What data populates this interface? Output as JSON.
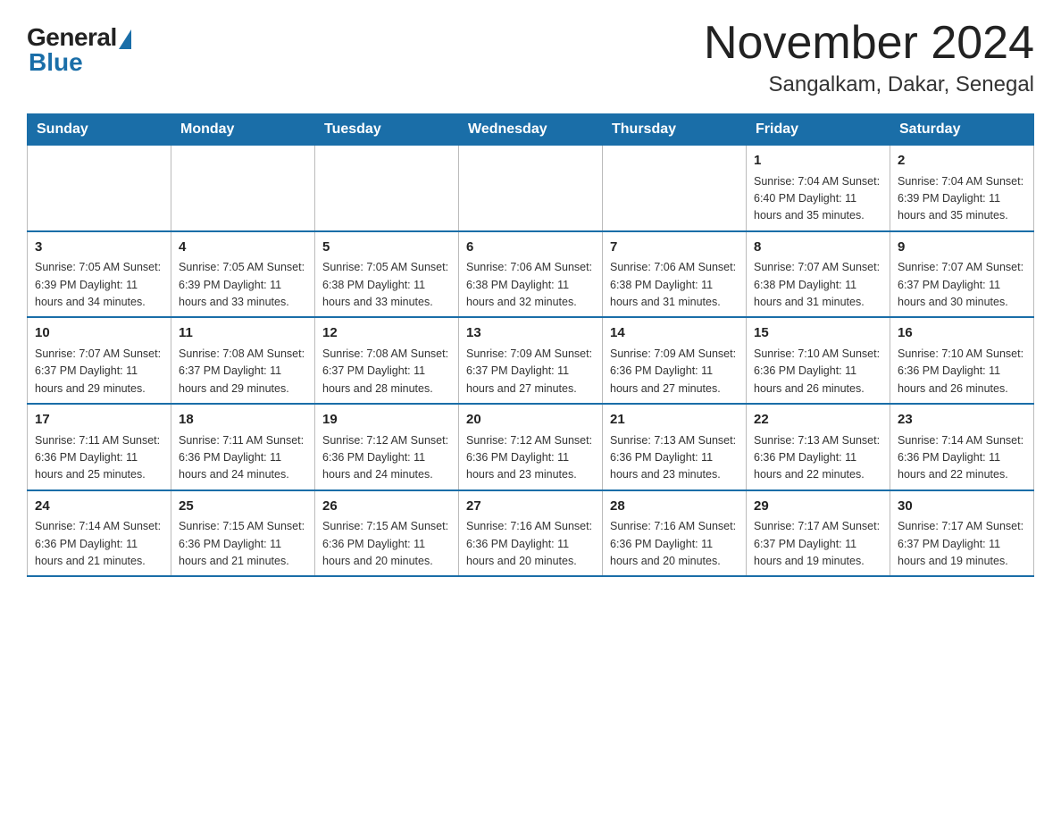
{
  "header": {
    "logo": {
      "general": "General",
      "blue": "Blue"
    },
    "month_title": "November 2024",
    "location": "Sangalkam, Dakar, Senegal"
  },
  "days_of_week": [
    "Sunday",
    "Monday",
    "Tuesday",
    "Wednesday",
    "Thursday",
    "Friday",
    "Saturday"
  ],
  "weeks": [
    [
      {
        "day": "",
        "info": ""
      },
      {
        "day": "",
        "info": ""
      },
      {
        "day": "",
        "info": ""
      },
      {
        "day": "",
        "info": ""
      },
      {
        "day": "",
        "info": ""
      },
      {
        "day": "1",
        "info": "Sunrise: 7:04 AM\nSunset: 6:40 PM\nDaylight: 11 hours and 35 minutes."
      },
      {
        "day": "2",
        "info": "Sunrise: 7:04 AM\nSunset: 6:39 PM\nDaylight: 11 hours and 35 minutes."
      }
    ],
    [
      {
        "day": "3",
        "info": "Sunrise: 7:05 AM\nSunset: 6:39 PM\nDaylight: 11 hours and 34 minutes."
      },
      {
        "day": "4",
        "info": "Sunrise: 7:05 AM\nSunset: 6:39 PM\nDaylight: 11 hours and 33 minutes."
      },
      {
        "day": "5",
        "info": "Sunrise: 7:05 AM\nSunset: 6:38 PM\nDaylight: 11 hours and 33 minutes."
      },
      {
        "day": "6",
        "info": "Sunrise: 7:06 AM\nSunset: 6:38 PM\nDaylight: 11 hours and 32 minutes."
      },
      {
        "day": "7",
        "info": "Sunrise: 7:06 AM\nSunset: 6:38 PM\nDaylight: 11 hours and 31 minutes."
      },
      {
        "day": "8",
        "info": "Sunrise: 7:07 AM\nSunset: 6:38 PM\nDaylight: 11 hours and 31 minutes."
      },
      {
        "day": "9",
        "info": "Sunrise: 7:07 AM\nSunset: 6:37 PM\nDaylight: 11 hours and 30 minutes."
      }
    ],
    [
      {
        "day": "10",
        "info": "Sunrise: 7:07 AM\nSunset: 6:37 PM\nDaylight: 11 hours and 29 minutes."
      },
      {
        "day": "11",
        "info": "Sunrise: 7:08 AM\nSunset: 6:37 PM\nDaylight: 11 hours and 29 minutes."
      },
      {
        "day": "12",
        "info": "Sunrise: 7:08 AM\nSunset: 6:37 PM\nDaylight: 11 hours and 28 minutes."
      },
      {
        "day": "13",
        "info": "Sunrise: 7:09 AM\nSunset: 6:37 PM\nDaylight: 11 hours and 27 minutes."
      },
      {
        "day": "14",
        "info": "Sunrise: 7:09 AM\nSunset: 6:36 PM\nDaylight: 11 hours and 27 minutes."
      },
      {
        "day": "15",
        "info": "Sunrise: 7:10 AM\nSunset: 6:36 PM\nDaylight: 11 hours and 26 minutes."
      },
      {
        "day": "16",
        "info": "Sunrise: 7:10 AM\nSunset: 6:36 PM\nDaylight: 11 hours and 26 minutes."
      }
    ],
    [
      {
        "day": "17",
        "info": "Sunrise: 7:11 AM\nSunset: 6:36 PM\nDaylight: 11 hours and 25 minutes."
      },
      {
        "day": "18",
        "info": "Sunrise: 7:11 AM\nSunset: 6:36 PM\nDaylight: 11 hours and 24 minutes."
      },
      {
        "day": "19",
        "info": "Sunrise: 7:12 AM\nSunset: 6:36 PM\nDaylight: 11 hours and 24 minutes."
      },
      {
        "day": "20",
        "info": "Sunrise: 7:12 AM\nSunset: 6:36 PM\nDaylight: 11 hours and 23 minutes."
      },
      {
        "day": "21",
        "info": "Sunrise: 7:13 AM\nSunset: 6:36 PM\nDaylight: 11 hours and 23 minutes."
      },
      {
        "day": "22",
        "info": "Sunrise: 7:13 AM\nSunset: 6:36 PM\nDaylight: 11 hours and 22 minutes."
      },
      {
        "day": "23",
        "info": "Sunrise: 7:14 AM\nSunset: 6:36 PM\nDaylight: 11 hours and 22 minutes."
      }
    ],
    [
      {
        "day": "24",
        "info": "Sunrise: 7:14 AM\nSunset: 6:36 PM\nDaylight: 11 hours and 21 minutes."
      },
      {
        "day": "25",
        "info": "Sunrise: 7:15 AM\nSunset: 6:36 PM\nDaylight: 11 hours and 21 minutes."
      },
      {
        "day": "26",
        "info": "Sunrise: 7:15 AM\nSunset: 6:36 PM\nDaylight: 11 hours and 20 minutes."
      },
      {
        "day": "27",
        "info": "Sunrise: 7:16 AM\nSunset: 6:36 PM\nDaylight: 11 hours and 20 minutes."
      },
      {
        "day": "28",
        "info": "Sunrise: 7:16 AM\nSunset: 6:36 PM\nDaylight: 11 hours and 20 minutes."
      },
      {
        "day": "29",
        "info": "Sunrise: 7:17 AM\nSunset: 6:37 PM\nDaylight: 11 hours and 19 minutes."
      },
      {
        "day": "30",
        "info": "Sunrise: 7:17 AM\nSunset: 6:37 PM\nDaylight: 11 hours and 19 minutes."
      }
    ]
  ]
}
